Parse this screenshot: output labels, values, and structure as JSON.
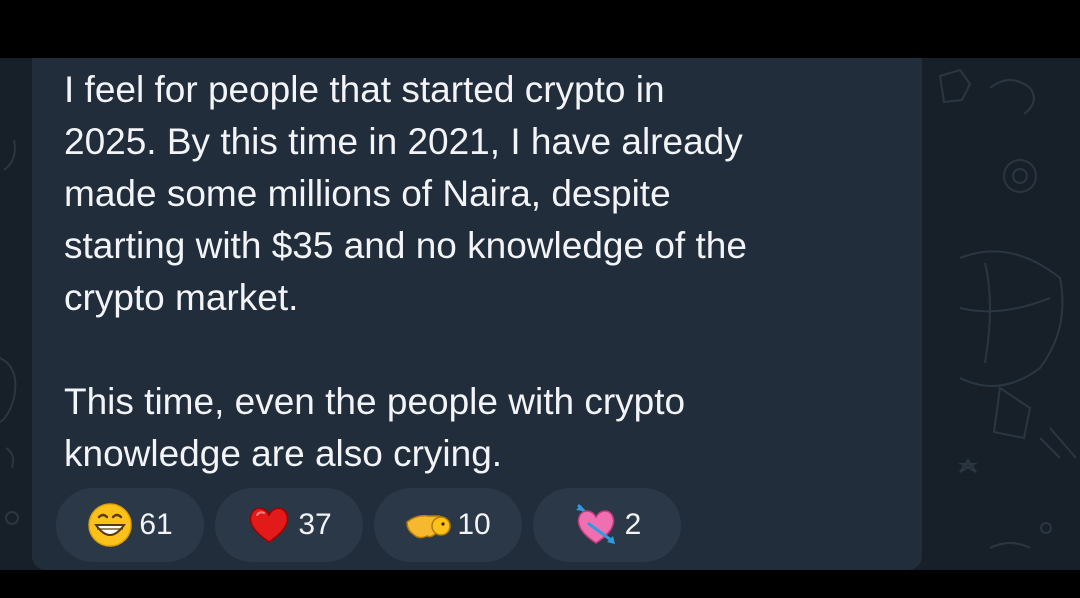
{
  "message": {
    "paragraph_1": "I feel for people that started crypto in\n2025. By this time in 2021, I have already\nmade some millions of Naira, despite\nstarting with $35 and no knowledge of the\ncrypto market.",
    "paragraph_2": "This time, even the people with crypto\nknowledge are also crying."
  },
  "reactions": [
    {
      "icon": "grinning-face-icon",
      "count": "61"
    },
    {
      "icon": "red-heart-icon",
      "count": "37"
    },
    {
      "icon": "pointing-hand-icon",
      "count": "10"
    },
    {
      "icon": "heart-with-arrow-icon",
      "count": "2"
    }
  ],
  "colors": {
    "chat_background": "#172029",
    "bubble": "#212d3b",
    "reaction_pill": "#2a3848",
    "text": "#f2f4f7"
  }
}
